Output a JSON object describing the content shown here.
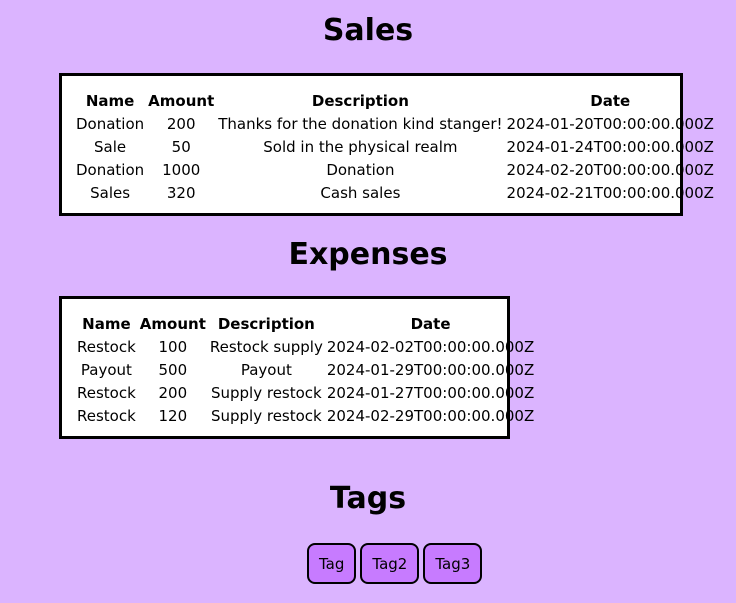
{
  "sales": {
    "title": "Sales",
    "columns": [
      "Name",
      "Amount",
      "Description",
      "Date"
    ],
    "rows": [
      [
        "Donation",
        "200",
        "Thanks for the donation kind stanger!",
        "2024-01-20T00:00:00.000Z"
      ],
      [
        "Sale",
        "50",
        "Sold in the physical realm",
        "2024-01-24T00:00:00.000Z"
      ],
      [
        "Donation",
        "1000",
        "Donation",
        "2024-02-20T00:00:00.000Z"
      ],
      [
        "Sales",
        "320",
        "Cash sales",
        "2024-02-21T00:00:00.000Z"
      ]
    ]
  },
  "expenses": {
    "title": "Expenses",
    "columns": [
      "Name",
      "Amount",
      "Description",
      "Date"
    ],
    "rows": [
      [
        "Restock",
        "100",
        "Restock supply",
        "2024-02-02T00:00:00.000Z"
      ],
      [
        "Payout",
        "500",
        "Payout",
        "2024-01-29T00:00:00.000Z"
      ],
      [
        "Restock",
        "200",
        "Supply restock",
        "2024-01-27T00:00:00.000Z"
      ],
      [
        "Restock",
        "120",
        "Supply restock",
        "2024-02-29T00:00:00.000Z"
      ]
    ]
  },
  "tags": {
    "title": "Tags",
    "items": [
      "Tag",
      "Tag2",
      "Tag3"
    ]
  },
  "colors": {
    "background": "#dbb4ff",
    "tag_fill": "#c77bff",
    "table_bg": "#ffffff",
    "border": "#000000"
  }
}
